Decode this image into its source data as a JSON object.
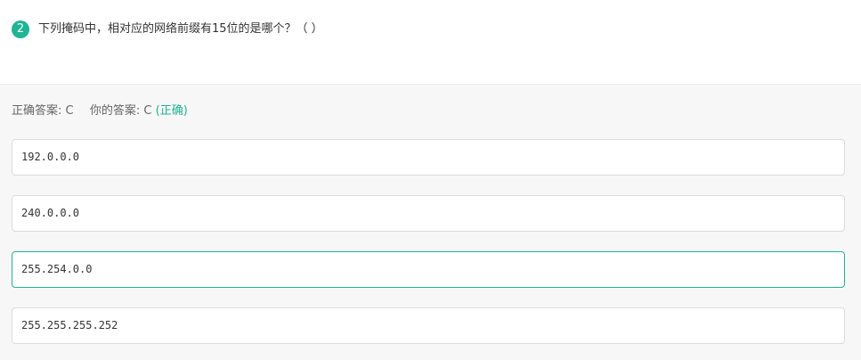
{
  "question": {
    "number": "2",
    "text": "下列掩码中，相对应的网络前缀有15位的是哪个？（ ）"
  },
  "result": {
    "correct_label": "正确答案:",
    "correct_value": "C",
    "yours_label": "你的答案:",
    "yours_value": "C",
    "status": "(正确)"
  },
  "options": [
    {
      "text": "192.0.0.0"
    },
    {
      "text": "240.0.0.0"
    },
    {
      "text": "255.254.0.0"
    },
    {
      "text": "255.255.255.252"
    }
  ],
  "colors": {
    "accent": "#1fb493",
    "panel_bg": "#f7f7f7",
    "border": "#dcdcdc"
  }
}
